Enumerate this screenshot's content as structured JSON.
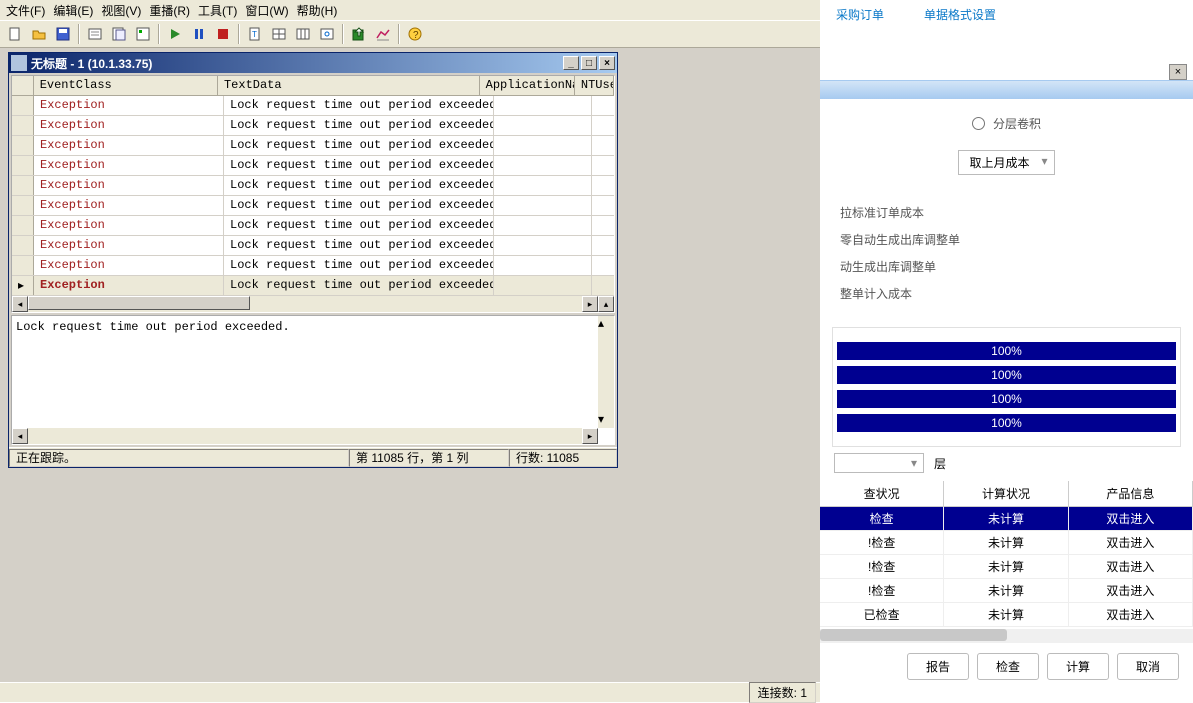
{
  "menu": {
    "file": "文件(F)",
    "edit": "编辑(E)",
    "view": "视图(V)",
    "replay": "重播(R)",
    "tools": "工具(T)",
    "window": "窗口(W)",
    "help": "帮助(H)"
  },
  "titlebar": {
    "text": "无标题 - 1 (10.1.33.75)"
  },
  "grid": {
    "headers": {
      "c1": "EventClass",
      "c2": "TextData",
      "c3": "ApplicationName",
      "c4": "NTUserN"
    },
    "rows": [
      {
        "c1": "Exception",
        "c2": "Lock request time out period exceeded."
      },
      {
        "c1": "Exception",
        "c2": "Lock request time out period exceeded."
      },
      {
        "c1": "Exception",
        "c2": "Lock request time out period exceeded."
      },
      {
        "c1": "Exception",
        "c2": "Lock request time out period exceeded."
      },
      {
        "c1": "Exception",
        "c2": "Lock request time out period exceeded."
      },
      {
        "c1": "Exception",
        "c2": "Lock request time out period exceeded."
      },
      {
        "c1": "Exception",
        "c2": "Lock request time out period exceeded."
      },
      {
        "c1": "Exception",
        "c2": "Lock request time out period exceeded."
      },
      {
        "c1": "Exception",
        "c2": "Lock request time out period exceeded."
      },
      {
        "c1": "Exception",
        "c2": "Lock request time out period exceeded."
      }
    ]
  },
  "detail": {
    "text": "Lock request time out period exceeded."
  },
  "status": {
    "tracking": "正在跟踪。",
    "position": "第 11085 行，第 1 列",
    "rows": "行数: 11085"
  },
  "globalStatus": {
    "conn": "连接数: 1"
  },
  "rightTop": {
    "link1": "采购订单",
    "link2": "单据格式设置"
  },
  "rp": {
    "radio": "分层卷积",
    "select": "取上月成本",
    "options": [
      "拉标准订单成本",
      "零自动生成出库调整单",
      "动生成出库调整单",
      "整单计入成本"
    ],
    "progress": [
      "100%",
      "100%",
      "100%",
      "100%"
    ],
    "fieldVal": "",
    "fieldLabel": "层",
    "th": {
      "c1": "查状况",
      "c2": "计算状况",
      "c3": "产品信息"
    },
    "trs": [
      {
        "c1": "检查",
        "c2": "未计算",
        "c3": "双击进入"
      },
      {
        "c1": "!检查",
        "c2": "未计算",
        "c3": "双击进入"
      },
      {
        "c1": "!检查",
        "c2": "未计算",
        "c3": "双击进入"
      },
      {
        "c1": "!检查",
        "c2": "未计算",
        "c3": "双击进入"
      },
      {
        "c1": "已检查",
        "c2": "未计算",
        "c3": "双击进入"
      }
    ],
    "btns": {
      "report": "报告",
      "check": "检查",
      "calc": "计算",
      "cancel": "取消"
    }
  }
}
